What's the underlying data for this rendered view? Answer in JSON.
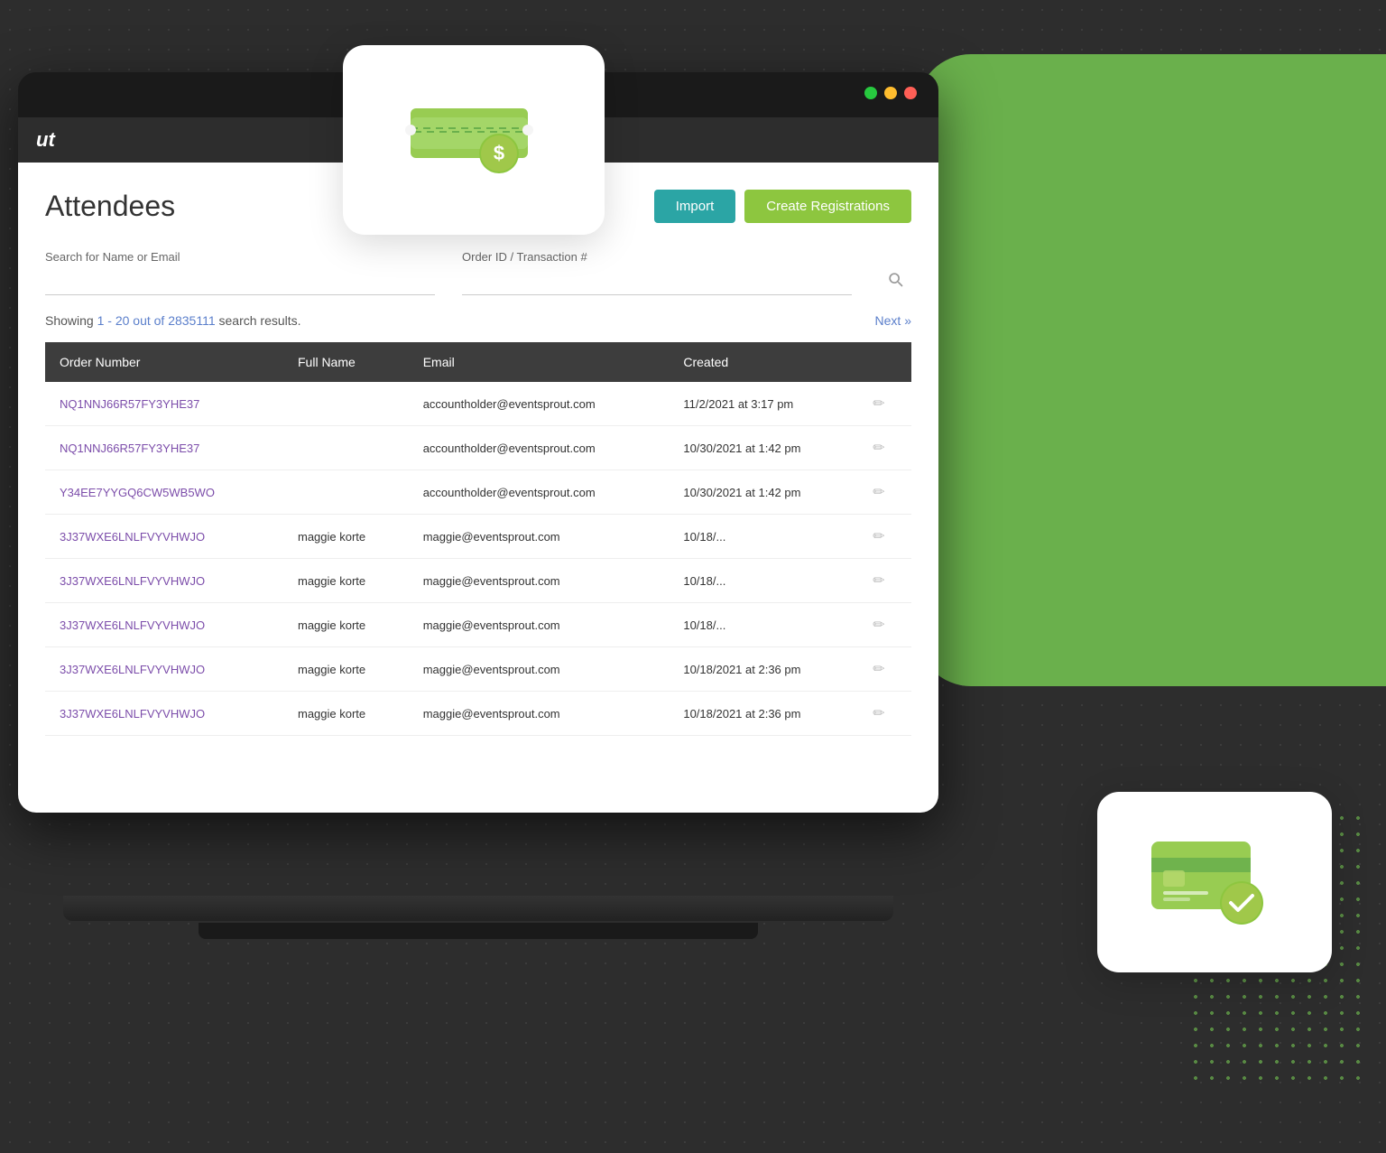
{
  "page": {
    "title": "Attendees",
    "logo": "ut"
  },
  "header": {
    "import_label": "Import",
    "create_label": "Create Registrations"
  },
  "search": {
    "name_label": "Search for Name or Email",
    "order_label": "Order ID / Transaction #",
    "name_placeholder": "",
    "order_placeholder": ""
  },
  "results": {
    "showing_prefix": "Showing ",
    "range": "1 - 20 out of 2835111",
    "showing_suffix": " search results.",
    "next_label": "Next »"
  },
  "table": {
    "columns": [
      "Order Number",
      "Full Name",
      "Email",
      "Created",
      ""
    ],
    "rows": [
      {
        "order": "NQ1NNJ66R57FY3YHE37",
        "name": "",
        "email": "accountholder@eventsprout.com",
        "created": "11/2/2021 at 3:17 pm"
      },
      {
        "order": "NQ1NNJ66R57FY3YHE37",
        "name": "",
        "email": "accountholder@eventsprout.com",
        "created": "10/30/2021 at 1:42 pm"
      },
      {
        "order": "Y34EE7YYGQ6CW5WB5WO",
        "name": "",
        "email": "accountholder@eventsprout.com",
        "created": "10/30/2021 at 1:42 pm"
      },
      {
        "order": "3J37WXE6LNLFVYVHWJO",
        "name": "maggie korte",
        "email": "maggie@eventsprout.com",
        "created": "10/18/..."
      },
      {
        "order": "3J37WXE6LNLFVYVHWJO",
        "name": "maggie korte",
        "email": "maggie@eventsprout.com",
        "created": "10/18/..."
      },
      {
        "order": "3J37WXE6LNLFVYVHWJO",
        "name": "maggie korte",
        "email": "maggie@eventsprout.com",
        "created": "10/18/..."
      },
      {
        "order": "3J37WXE6LNLFVYVHWJO",
        "name": "maggie korte",
        "email": "maggie@eventsprout.com",
        "created": "10/18/2021 at 2:36 pm"
      },
      {
        "order": "3J37WXE6LNLFVYVHWJO",
        "name": "maggie korte",
        "email": "maggie@eventsprout.com",
        "created": "10/18/2021 at 2:36 pm"
      }
    ]
  },
  "traffic_lights": {
    "green": "#27c93f",
    "yellow": "#ffbd2e",
    "red": "#ff5f56"
  }
}
